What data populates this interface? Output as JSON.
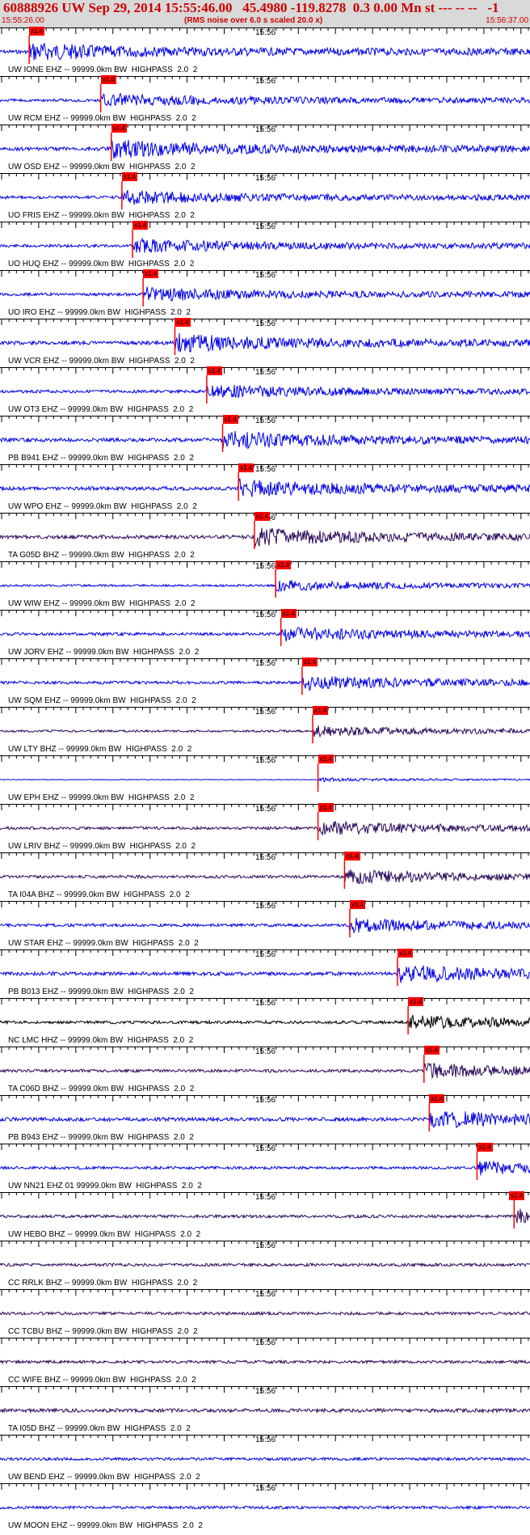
{
  "header": {
    "title": "60888926 UW Sep 29, 2014 15:55:46.00   45.4980 -119.8278  0.3 0.00 Mn st --- -- --   -1",
    "start_time": "15:55:26.00",
    "end_time": "15:56:37.00",
    "scale_note": "(RMS noise over 6.0 s scaled 20.0 x)"
  },
  "colors": {
    "background": "#ffffff",
    "header_bg": "#d9d9d9",
    "header_text": "#cc0000",
    "trace_blue": "#0000e6",
    "trace_dark": "#2a0a5a",
    "trace_black": "#000000",
    "pick_box": "#ff0000"
  },
  "chart_data": {
    "type": "line",
    "title": "60888926 UW Sep 29, 2014 15:55:46.00   45.4980 -119.8278  0.3 0.00 Mn st --- -- --   -1",
    "x_range": [
      "15:55:26.00",
      "15:56:37.00"
    ],
    "tick_label": "15:56",
    "pick_label": "x1.4",
    "series": [
      {
        "name": "UW IONE EHZ -- 99999.0km BW  HIGHPASS  2.0  2",
        "color": "trace_blue",
        "pick_fraction": 0.055,
        "amp": 0.5
      },
      {
        "name": "UW RCM EHZ -- 99999.0km BW  HIGHPASS  2.0  2",
        "color": "trace_blue",
        "pick_fraction": 0.19,
        "amp": 0.4
      },
      {
        "name": "UW OSD EHZ -- 99999.0km BW  HIGHPASS  2.0  2",
        "color": "trace_blue",
        "pick_fraction": 0.21,
        "amp": 0.5
      },
      {
        "name": "UO FRIS EHZ -- 99999.0km BW  HIGHPASS  2.0  2",
        "color": "trace_blue",
        "pick_fraction": 0.23,
        "amp": 0.4
      },
      {
        "name": "UO HUQ EHZ -- 99999.0km BW  HIGHPASS  2.0  2",
        "color": "trace_blue",
        "pick_fraction": 0.25,
        "amp": 0.4
      },
      {
        "name": "UO IRO EHZ -- 99999.0km BW  HIGHPASS  2.0  2",
        "color": "trace_blue",
        "pick_fraction": 0.27,
        "amp": 0.4
      },
      {
        "name": "UW VCR EHZ -- 99999.0km BW  HIGHPASS  2.0  2",
        "color": "trace_blue",
        "pick_fraction": 0.33,
        "amp": 0.5
      },
      {
        "name": "UW OT3 EHZ -- 99999.0km BW  HIGHPASS  2.0  2",
        "color": "trace_blue",
        "pick_fraction": 0.39,
        "amp": 0.4
      },
      {
        "name": "PB B941 EHZ -- 99999.0km BW  HIGHPASS  2.0  2",
        "color": "trace_blue",
        "pick_fraction": 0.42,
        "amp": 0.5
      },
      {
        "name": "UW WPO EHZ -- 99999.0km BW  HIGHPASS  2.0  2",
        "color": "trace_blue",
        "pick_fraction": 0.45,
        "amp": 0.5
      },
      {
        "name": "TA G05D BHZ -- 99999.0km BW  HIGHPASS  2.0  2",
        "color": "trace_dark",
        "pick_fraction": 0.48,
        "amp": 0.5
      },
      {
        "name": "UW WIW EHZ -- 99999.0km BW  HIGHPASS  2.0  2",
        "color": "trace_blue",
        "pick_fraction": 0.52,
        "amp": 0.3
      },
      {
        "name": "UW JORV EHZ -- 99999.0km BW  HIGHPASS  2.0  2",
        "color": "trace_blue",
        "pick_fraction": 0.53,
        "amp": 0.4
      },
      {
        "name": "UW SQM EHZ -- 99999.0km BW  HIGHPASS  2.0  2",
        "color": "trace_blue",
        "pick_fraction": 0.57,
        "amp": 0.4
      },
      {
        "name": "UW LTY BHZ -- 99999.0km BW  HIGHPASS  2.0  2",
        "color": "trace_dark",
        "pick_fraction": 0.59,
        "amp": 0.3
      },
      {
        "name": "UW EPH EHZ -- 99999.0km BW  HIGHPASS  2.0  2",
        "color": "trace_blue",
        "pick_fraction": 0.6,
        "amp": 0.1
      },
      {
        "name": "UW LRIV BHZ -- 99999.0km BW  HIGHPASS  2.0  2",
        "color": "trace_dark",
        "pick_fraction": 0.6,
        "amp": 0.4
      },
      {
        "name": "TA I04A BHZ -- 99999.0km BW  HIGHPASS  2.0  2",
        "color": "trace_dark",
        "pick_fraction": 0.65,
        "amp": 0.4
      },
      {
        "name": "UW STAR EHZ -- 99999.0km BW  HIGHPASS  2.0  2",
        "color": "trace_blue",
        "pick_fraction": 0.66,
        "amp": 0.4
      },
      {
        "name": "PB B013 EHZ -- 99999.0km BW  HIGHPASS  2.0  2",
        "color": "trace_blue",
        "pick_fraction": 0.75,
        "amp": 0.5
      },
      {
        "name": "NC LMC HHZ -- 99999.0km BW  HIGHPASS  2.0  2",
        "color": "trace_black",
        "pick_fraction": 0.77,
        "amp": 0.4
      },
      {
        "name": "TA C06D BHZ -- 99999.0km BW  HIGHPASS  2.0  2",
        "color": "trace_dark",
        "pick_fraction": 0.8,
        "amp": 0.4
      },
      {
        "name": "PB B943 EHZ -- 99999.0km BW  HIGHPASS  2.0  2",
        "color": "trace_blue",
        "pick_fraction": 0.81,
        "amp": 0.5
      },
      {
        "name": "UW NN21 EHZ 01 99999.0km BW  HIGHPASS  2.0  2",
        "color": "trace_blue",
        "pick_fraction": 0.9,
        "amp": 0.4
      },
      {
        "name": "UW HEBO BHZ -- 99999.0km BW  HIGHPASS  2.0  2",
        "color": "trace_dark",
        "pick_fraction": 0.97,
        "amp": 0.4
      },
      {
        "name": "CC RRLK BHZ -- 99999.0km BW  HIGHPASS  2.0  2",
        "color": "trace_dark",
        "pick_fraction": null,
        "amp": 0.4
      },
      {
        "name": "CC TCBU BHZ -- 99999.0km BW  HIGHPASS  2.0  2",
        "color": "trace_dark",
        "pick_fraction": null,
        "amp": 0.4
      },
      {
        "name": "CC WIFE BHZ -- 99999.0km BW  HIGHPASS  2.0  2",
        "color": "trace_dark",
        "pick_fraction": null,
        "amp": 0.4
      },
      {
        "name": "TA I05D BHZ -- 99999.0km BW  HIGHPASS  2.0  2",
        "color": "trace_dark",
        "pick_fraction": null,
        "amp": 0.5
      },
      {
        "name": "UW BEND EHZ -- 99999.0km BW  HIGHPASS  2.0  2",
        "color": "trace_blue",
        "pick_fraction": null,
        "amp": 0.4
      },
      {
        "name": "UW MOON EHZ -- 99999.0km BW  HIGHPASS  2.0  2",
        "color": "trace_blue",
        "pick_fraction": null,
        "amp": 0.4
      }
    ]
  }
}
